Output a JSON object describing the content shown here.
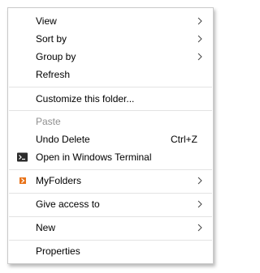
{
  "menu": {
    "items": [
      {
        "label": "View",
        "submenu": true
      },
      {
        "label": "Sort by",
        "submenu": true
      },
      {
        "label": "Group by",
        "submenu": true
      },
      {
        "label": "Refresh",
        "submenu": false
      },
      {
        "label": "Customize this folder...",
        "submenu": false
      },
      {
        "label": "Paste",
        "submenu": false,
        "disabled": true
      },
      {
        "label": "Undo Delete",
        "shortcut": "Ctrl+Z"
      },
      {
        "label": "Open in Windows Terminal",
        "icon": "terminal-icon"
      },
      {
        "label": "MyFolders",
        "submenu": true,
        "icon": "myfolders-icon"
      },
      {
        "label": "Give access to",
        "submenu": true
      },
      {
        "label": "New",
        "submenu": true
      },
      {
        "label": "Properties",
        "submenu": false
      }
    ]
  },
  "colors": {
    "text": "#000000",
    "disabled_text": "#8f8f8f",
    "separator": "#e3e3e3",
    "border": "#c9c9c9",
    "myfolders_icon": "#e8731a"
  }
}
